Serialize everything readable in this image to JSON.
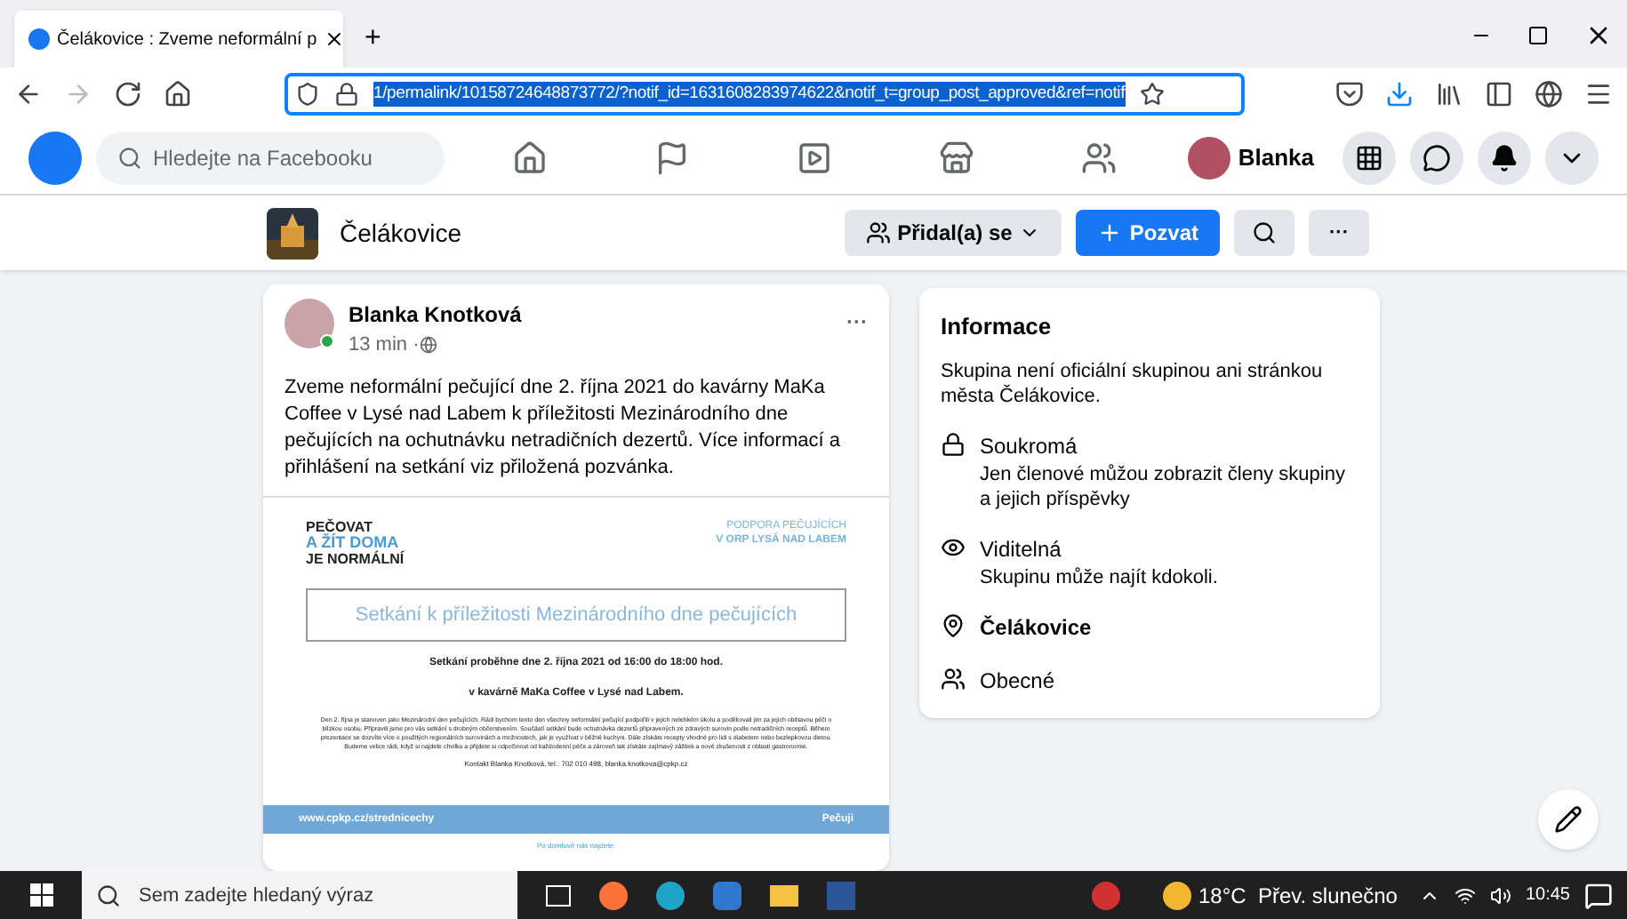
{
  "browser": {
    "tabs": [
      {
        "title": "Čelákovice : Zveme neformální p",
        "selected": true
      }
    ],
    "new_tab": "+",
    "url": "1/permalink/10158724648873772/?notif_id=1631608283974622&notif_t=group_post_approved&ref=notif"
  },
  "facebook": {
    "search": {
      "placeholder": "Hledejte na Facebooku"
    },
    "nav": [
      {
        "kind": "home",
        "selected": false
      },
      {
        "kind": "flag",
        "selected": false
      },
      {
        "kind": "video",
        "selected": false
      },
      {
        "kind": "store",
        "selected": false
      },
      {
        "kind": "groups",
        "selected": false
      }
    ],
    "profile_name": "Blanka"
  },
  "group": {
    "name": "Čelákovice",
    "joined_button": "Přidal(a) se",
    "invite_button": "Pozvat",
    "more_button": "···"
  },
  "post": {
    "author": "Blanka Knotková",
    "time": "13 min · ",
    "online": true,
    "more": "···",
    "text": "Zveme neformální pečující dne 2. října 2021 do kavárny MaKa Coffee v Lysé nad Labem k příležitosti Mezinárodního dne pečujících na ochutnávku netradičních dezertů. Více informací a přihlášení na setkání viz přiložená pozvánka.",
    "flyer": {
      "logo_lines": [
        "PEČOVAT",
        "A ŽÍT DOMA",
        "JE NORMÁLNÍ"
      ],
      "org_lines": [
        "PODPORA PEČUJÍCÍCH",
        "V ORP LYSÁ NAD LABEM"
      ],
      "heading": "Setkání k příležitosti Mezinárodního dne pečujících",
      "details": [
        "Setkání proběhne dne 2. října 2021 od 16:00 do 18:00 hod.",
        "v kavárně MaKa Coffee v Lysé nad Labem."
      ],
      "body": "Den 2. října je stanoven jako Mezinárodní den pečujících. Rádi bychom tento den všechny neformální pečující podpořili v jejich nelehkém úkolu a poděkovali jim za jejich obětavou péči o blízkou osobu. Připravili jsme pro vás setkání s drobným občerstvením. Součástí setkání bude ochutnávka dezertů připravených ze zdravých surovin podle netradičních receptů. Během prezentace se dozvíte více o použitých regionálních surovinách a možnostech, jak je využívat v běžné kuchyni. Dále získáte recepty vhodné pro lidi s diabetem nebo bezlepkovou dietou. Budeme velice rádi, když si najdete chvilku a přijdete si odpočinout od každodenní péče a zároveň tak získáte zajímavý zážitek a nové zkušenosti z oblasti gastronomie.",
      "contact": "Kontakt Blanka Knotková, tel.: 702 010 498, blanka.knotkova@cpkp.cz",
      "url": "www.cpkp.cz/strednicechy",
      "social": "Pečuji",
      "footer": "Po domluvě nás najdete:"
    }
  },
  "info": {
    "title": "Informace",
    "description": "Skupina není oficiální skupinou ani stránkou města Čelákovice.",
    "items": [
      {
        "kind": "lock",
        "title": "Soukromá",
        "detail": "Jen členové můžou zobrazit členy skupiny a jejich příspěvky"
      },
      {
        "kind": "eye",
        "title": "Viditelná",
        "detail": "Skupinu může najít kdokoli."
      },
      {
        "kind": "pin",
        "title": "Čelákovice"
      },
      {
        "kind": "people",
        "title": "Obecné"
      }
    ]
  },
  "taskbar": {
    "search": {
      "placeholder": "Sem zadejte hledaný výraz"
    },
    "weather": "18°C  Přev. slunečno",
    "time": "10:45"
  }
}
